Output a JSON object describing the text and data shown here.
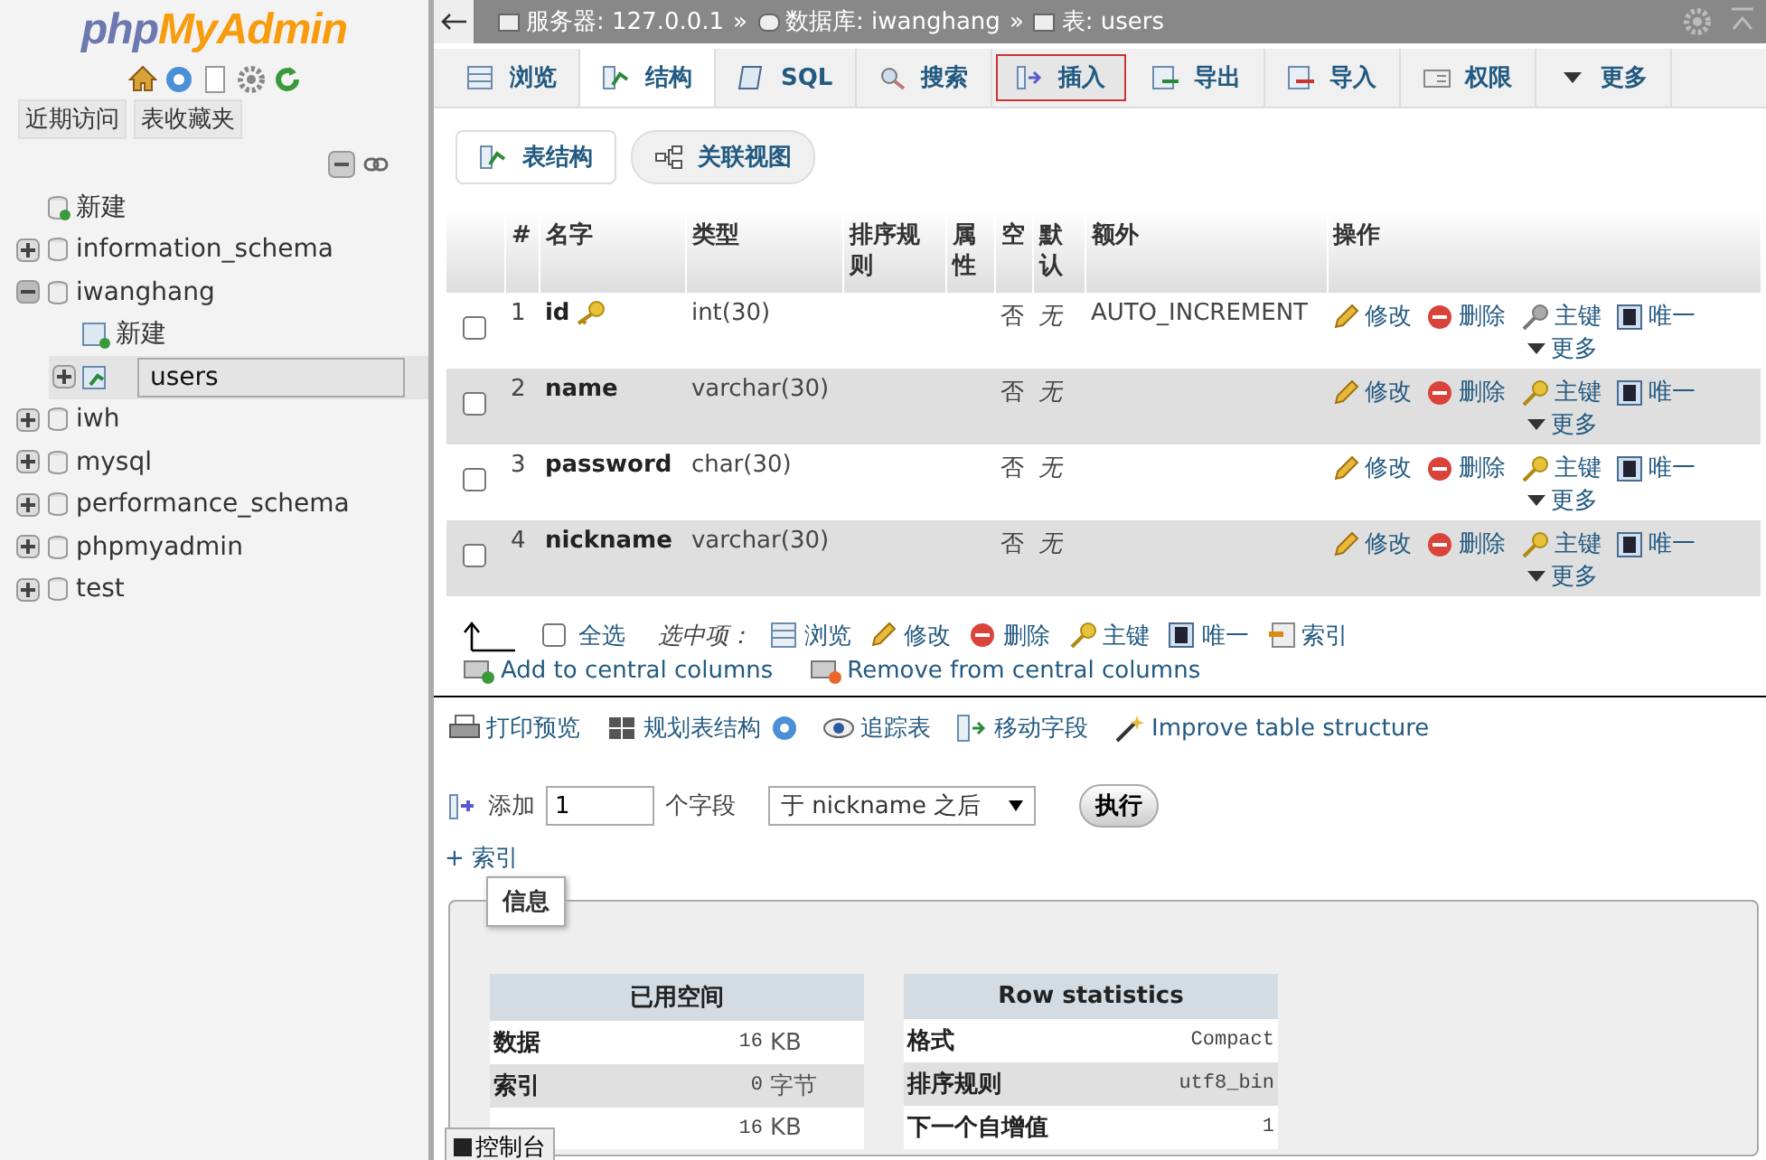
{
  "sidebar": {
    "logo": {
      "php": "php",
      "rest": "MyAdmin"
    },
    "buttons": [
      "近期访问",
      "表收藏夹"
    ],
    "tree": [
      {
        "label": "新建",
        "kind": "new",
        "selected": false
      },
      {
        "label": "information_schema",
        "kind": "db",
        "expanded": false,
        "selected": false
      },
      {
        "label": "iwanghang",
        "kind": "db",
        "expanded": true,
        "selected": false,
        "children": [
          {
            "label": "新建",
            "kind": "newtable",
            "selected": false
          },
          {
            "label": "users",
            "kind": "table",
            "expanded": false,
            "selected": true
          }
        ]
      },
      {
        "label": "iwh",
        "kind": "db",
        "expanded": false,
        "selected": false
      },
      {
        "label": "mysql",
        "kind": "db",
        "expanded": false,
        "selected": false
      },
      {
        "label": "performance_schema",
        "kind": "db",
        "expanded": false,
        "selected": false
      },
      {
        "label": "phpmyadmin",
        "kind": "db",
        "expanded": false,
        "selected": false
      },
      {
        "label": "test",
        "kind": "db",
        "expanded": false,
        "selected": false
      }
    ]
  },
  "breadcrumb": [
    {
      "label": "服务器: 127.0.0.1",
      "kind": "server"
    },
    {
      "sep": "»",
      "label": "数据库: iwanghang",
      "kind": "db"
    },
    {
      "sep": "»",
      "label": "表: users",
      "kind": "table"
    }
  ],
  "tabs": [
    {
      "label": "浏览",
      "kind": "browse",
      "selected": false,
      "highlighted": false
    },
    {
      "label": "结构",
      "kind": "structure",
      "selected": true,
      "highlighted": false
    },
    {
      "label": "SQL",
      "kind": "sql",
      "selected": false,
      "highlighted": false
    },
    {
      "label": "搜索",
      "kind": "search",
      "selected": false,
      "highlighted": false
    },
    {
      "label": "插入",
      "kind": "insert",
      "selected": false,
      "highlighted": true
    },
    {
      "label": "导出",
      "kind": "export",
      "selected": false,
      "highlighted": false
    },
    {
      "label": "导入",
      "kind": "import",
      "selected": false,
      "highlighted": false
    },
    {
      "label": "权限",
      "kind": "privileges",
      "selected": false,
      "highlighted": false
    },
    {
      "label": "更多",
      "kind": "more",
      "selected": false,
      "highlighted": false
    }
  ],
  "subtabs": [
    {
      "label": "表结构",
      "selected": true
    },
    {
      "label": "关联视图",
      "selected": false
    }
  ],
  "table": {
    "columns": [
      "#",
      "名字",
      "类型",
      "排序规则",
      "属性",
      "空",
      "默认",
      "额外",
      "操作"
    ],
    "rows": [
      {
        "num": "1",
        "name": "id",
        "primary": true,
        "type": "int(30)",
        "null": "否",
        "default": "无",
        "extra": "AUTO_INCREMENT",
        "checked": false,
        "actions": {
          "edit": "修改",
          "drop": "删除",
          "primary": "主键",
          "unique": "唯一",
          "more": "更多"
        }
      },
      {
        "num": "2",
        "name": "name",
        "primary": false,
        "type": "varchar(30)",
        "null": "否",
        "default": "无",
        "extra": "",
        "checked": false,
        "actions": {
          "edit": "修改",
          "drop": "删除",
          "primary": "主键",
          "unique": "唯一",
          "more": "更多"
        }
      },
      {
        "num": "3",
        "name": "password",
        "primary": false,
        "type": "char(30)",
        "null": "否",
        "default": "无",
        "extra": "",
        "checked": false,
        "actions": {
          "edit": "修改",
          "drop": "删除",
          "primary": "主键",
          "unique": "唯一",
          "more": "更多"
        }
      },
      {
        "num": "4",
        "name": "nickname",
        "primary": false,
        "type": "varchar(30)",
        "null": "否",
        "default": "无",
        "extra": "",
        "checked": false,
        "actions": {
          "edit": "修改",
          "drop": "删除",
          "primary": "主键",
          "unique": "唯一",
          "more": "更多"
        }
      }
    ]
  },
  "bulk": {
    "check_all": "全选",
    "checked": false,
    "with_selected": "选中项：",
    "actions": [
      {
        "label": "浏览",
        "kind": "browse"
      },
      {
        "label": "修改",
        "kind": "edit"
      },
      {
        "label": "删除",
        "kind": "drop"
      },
      {
        "label": "主键",
        "kind": "primary"
      },
      {
        "label": "唯一",
        "kind": "unique"
      },
      {
        "label": "索引",
        "kind": "index"
      }
    ],
    "central": [
      {
        "label": "Add to central columns",
        "kind": "add"
      },
      {
        "label": "Remove from central columns",
        "kind": "remove"
      }
    ]
  },
  "tools": [
    {
      "label": "打印预览",
      "kind": "print"
    },
    {
      "label": "规划表结构",
      "kind": "plan"
    },
    {
      "label": "追踪表",
      "kind": "track"
    },
    {
      "label": "移动字段",
      "kind": "move"
    },
    {
      "label": "Improve table structure",
      "kind": "improve"
    }
  ],
  "add_field": {
    "label": "添加",
    "value": "1",
    "unit": "个字段",
    "position": "于 nickname 之后",
    "go": "执行",
    "index_link": "+ 索引"
  },
  "info": {
    "legend": "信息",
    "space": {
      "title": "已用空间",
      "rows": [
        {
          "label": "数据",
          "value": "16",
          "unit": "KB"
        },
        {
          "label": "索引",
          "value": "0",
          "unit": "字节"
        },
        {
          "label": "",
          "value": "16",
          "unit": "KB"
        }
      ]
    },
    "stats": {
      "title": "Row statistics",
      "rows": [
        {
          "label": "格式",
          "value": "Compact"
        },
        {
          "label": "排序规则",
          "value": "utf8_bin"
        },
        {
          "label": "下一个自增值",
          "value": "1"
        }
      ]
    }
  },
  "console": "控制台"
}
